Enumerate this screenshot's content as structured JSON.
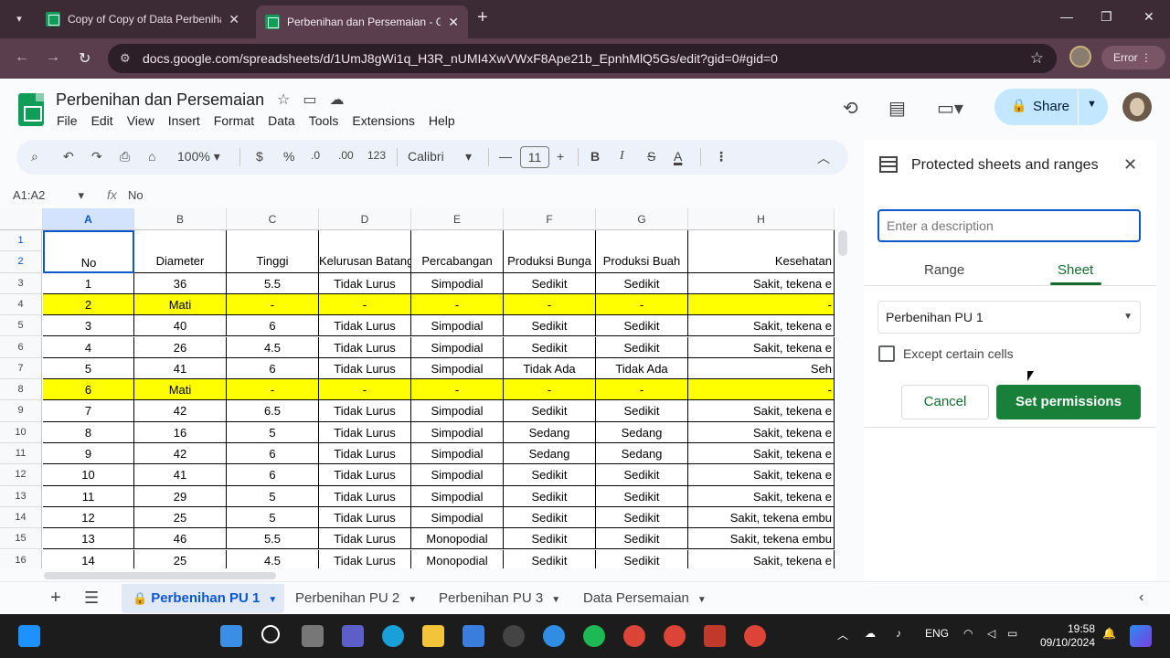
{
  "browser": {
    "tabs": [
      {
        "title": "Copy of Copy of Data Perbenihan",
        "active": false
      },
      {
        "title": "Perbenihan dan Persemaian - G",
        "active": true
      }
    ],
    "url": "docs.google.com/spreadsheets/d/1UmJ8gWi1q_H3R_nUMI4XwVWxF8Ape21b_EpnhMlQ5Gs/edit?gid=0#gid=0",
    "error_label": "Error"
  },
  "doc": {
    "title": "Perbenihan dan Persemaian",
    "menu": [
      "File",
      "Edit",
      "View",
      "Insert",
      "Format",
      "Data",
      "Tools",
      "Extensions",
      "Help"
    ],
    "share_label": "Share"
  },
  "toolbar": {
    "zoom": "100%",
    "currency": "$",
    "percent": "%",
    "dec_decrease": ".0",
    "dec_increase": ".00",
    "number_format": "123",
    "font": "Calibri",
    "font_size": "11"
  },
  "formula_bar": {
    "name_box": "A1:A2",
    "fx": "fx",
    "content": "No"
  },
  "grid": {
    "columns": [
      "A",
      "B",
      "C",
      "D",
      "E",
      "F",
      "G",
      "H"
    ],
    "row_numbers": [
      "1",
      "2",
      "3",
      "4",
      "5",
      "6",
      "7",
      "8",
      "9",
      "10",
      "11",
      "12",
      "13",
      "14",
      "15",
      "16"
    ],
    "headers": [
      "No",
      "Diameter",
      "Tinggi",
      "Kelurusan Batang",
      "Percabangan",
      "Produksi Bunga",
      "Produksi Buah",
      "Kesehatan"
    ],
    "rows": [
      [
        "1",
        "36",
        "5.5",
        "Tidak Lurus",
        "Simpodial",
        "Sedikit",
        "Sedikit",
        "Sakit, tekena e"
      ],
      [
        "2",
        "Mati",
        "-",
        "-",
        "-",
        "-",
        "-",
        "-"
      ],
      [
        "3",
        "40",
        "6",
        "Tidak Lurus",
        "Simpodial",
        "Sedikit",
        "Sedikit",
        "Sakit, tekena e"
      ],
      [
        "4",
        "26",
        "4.5",
        "Tidak Lurus",
        "Simpodial",
        "Sedikit",
        "Sedikit",
        "Sakit, tekena e"
      ],
      [
        "5",
        "41",
        "6",
        "Tidak Lurus",
        "Simpodial",
        "Tidak Ada",
        "Tidak Ada",
        "Seh"
      ],
      [
        "6",
        "Mati",
        "-",
        "-",
        "-",
        "-",
        "-",
        "-"
      ],
      [
        "7",
        "42",
        "6.5",
        "Tidak Lurus",
        "Simpodial",
        "Sedikit",
        "Sedikit",
        "Sakit, tekena e"
      ],
      [
        "8",
        "16",
        "5",
        "Tidak Lurus",
        "Simpodial",
        "Sedang",
        "Sedang",
        "Sakit, tekena e"
      ],
      [
        "9",
        "42",
        "6",
        "Tidak Lurus",
        "Simpodial",
        "Sedang",
        "Sedang",
        "Sakit, tekena e"
      ],
      [
        "10",
        "41",
        "6",
        "Tidak Lurus",
        "Simpodial",
        "Sedikit",
        "Sedikit",
        "Sakit, tekena e"
      ],
      [
        "11",
        "29",
        "5",
        "Tidak Lurus",
        "Simpodial",
        "Sedikit",
        "Sedikit",
        "Sakit, tekena e"
      ],
      [
        "12",
        "25",
        "5",
        "Tidak Lurus",
        "Simpodial",
        "Sedikit",
        "Sedikit",
        "Sakit, tekena embu"
      ],
      [
        "13",
        "46",
        "5.5",
        "Tidak Lurus",
        "Monopodial",
        "Sedikit",
        "Sedikit",
        "Sakit, tekena embu"
      ],
      [
        "14",
        "25",
        "4.5",
        "Tidak Lurus",
        "Monopodial",
        "Sedikit",
        "Sedikit",
        "Sakit, tekena e"
      ]
    ],
    "highlight_color": "#ffff00"
  },
  "panel": {
    "title": "Protected sheets and ranges",
    "description_placeholder": "Enter a description",
    "tab_range": "Range",
    "tab_sheet": "Sheet",
    "selected_sheet": "Perbenihan PU 1",
    "except_label": "Except certain cells",
    "cancel_label": "Cancel",
    "set_permissions_label": "Set permissions"
  },
  "sheet_tabs": [
    "Perbenihan PU 1",
    "Perbenihan PU 2",
    "Perbenihan PU 3",
    "Data Persemaian"
  ],
  "taskbar": {
    "language": "ENG",
    "time": "19:58",
    "date": "09/10/2024"
  },
  "colors": {
    "accent_green": "#188038",
    "share_blue": "#c2e7ff",
    "selected_blue": "#0b57d0"
  }
}
